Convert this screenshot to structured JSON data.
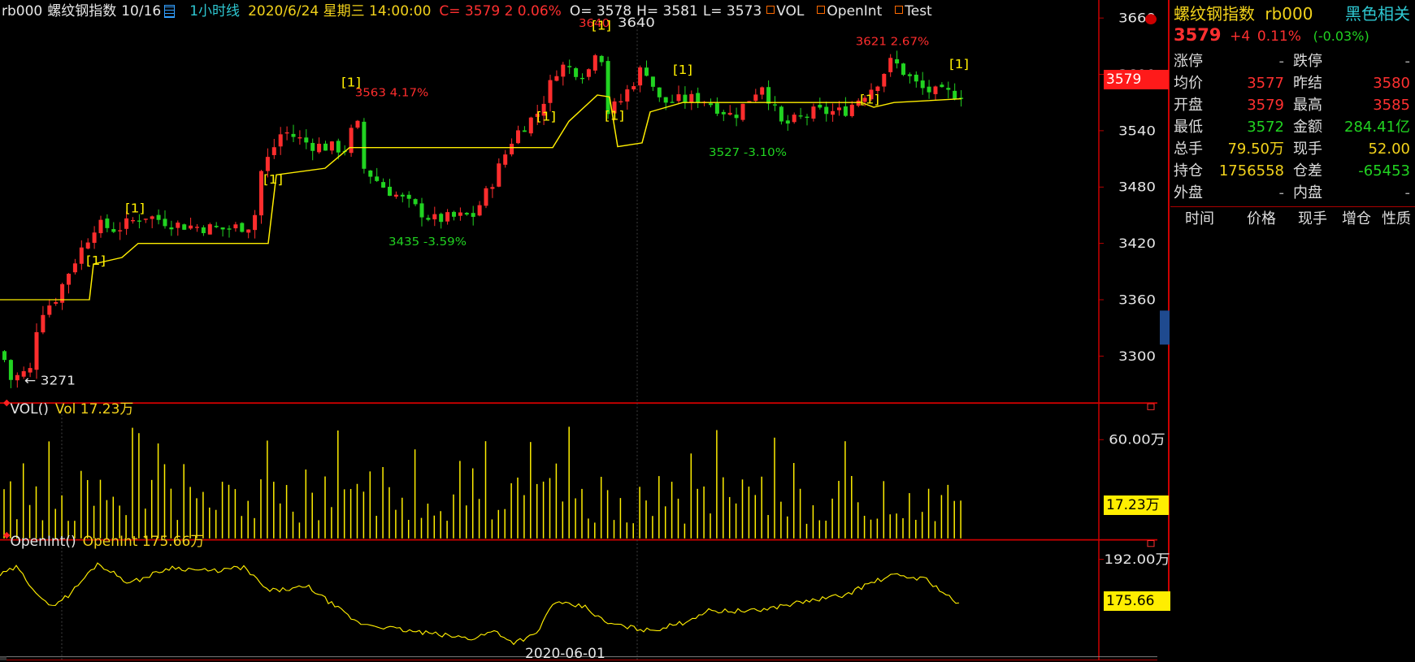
{
  "header": {
    "symbol": "rb000",
    "name": "螺纹钢指数",
    "ratio": "10/16",
    "period": "1小时线",
    "datetime": "2020/6/24 星期三 14:00:00",
    "close": "C= 3579  2  0.06%",
    "open": "O= 3578",
    "high": "H= 3581",
    "low": "L= 3573",
    "ind1": "VOL",
    "ind2": "OpenInt",
    "ind3": "Test"
  },
  "colors": {
    "up": "#ff2d2d",
    "down": "#21d321",
    "yellow": "#ffee00",
    "grid": "#7a0000",
    "axis": "#cc0000"
  },
  "price_axis": {
    "ticks": [
      "3660",
      "3600",
      "3540",
      "3480",
      "3420",
      "3360",
      "3300"
    ],
    "current_tag": "3579"
  },
  "annotations": {
    "low_mark": "3271",
    "peak1": "3563 4.17%",
    "trough1": "3435 -3.59%",
    "peak2_pct": "3640 ",
    "peak2_val": "3640",
    "trough2": "3527 -3.10%",
    "peak3": "3621 2.67%",
    "signal": "[1]"
  },
  "vol_panel": {
    "title": "VOL()",
    "value_label": "Vol 17.23万",
    "tick": "60.00万",
    "current_tag": "17.23万"
  },
  "oi_panel": {
    "title": "OpenInt()",
    "value_label": "OpenInt 175.66万",
    "tick": "192.00万",
    "current_tag": "175.66万"
  },
  "date_axis": {
    "label": "2020-06-01"
  },
  "quote_panel": {
    "title": "螺纹钢指数",
    "code": "rb000",
    "related": "黑色相关",
    "last": "3579",
    "change": "+4",
    "change_pct": "0.11%",
    "change_pct2": "(-0.03%)",
    "rows": [
      {
        "l1": "涨停",
        "v1": "-",
        "l2": "跌停",
        "v2": "-"
      },
      {
        "l1": "均价",
        "v1": "3577",
        "l2": "昨结",
        "v2": "3580"
      },
      {
        "l1": "开盘",
        "v1": "3579",
        "l2": "最高",
        "v2": "3585"
      },
      {
        "l1": "最低",
        "v1": "3572",
        "l2": "金额",
        "v2": "284.41亿"
      },
      {
        "l1": "总手",
        "v1": "79.50万",
        "l2": "现手",
        "v2": "52.00"
      },
      {
        "l1": "持仓",
        "v1": "1756558",
        "l2": "仓差",
        "v2": "-65453"
      },
      {
        "l1": "外盘",
        "v1": "-",
        "l2": "内盘",
        "v2": "-"
      }
    ],
    "tick_headers": [
      "时间",
      "价格",
      "现手",
      "增仓",
      "性质"
    ]
  },
  "chart_data": {
    "type": "candlestick",
    "title": "螺纹钢指数 1小时线",
    "ylim": [
      3250,
      3665
    ],
    "yticks": [
      3300,
      3360,
      3420,
      3480,
      3540,
      3600,
      3660
    ],
    "x_label": "2020-06-01",
    "key_points": [
      {
        "label": "low",
        "value": 3271
      },
      {
        "label": "peak",
        "value": 3563,
        "pct": "4.17%"
      },
      {
        "label": "trough",
        "value": 3435,
        "pct": "-3.59%"
      },
      {
        "label": "peak",
        "value": 3640
      },
      {
        "label": "trough",
        "value": 3527,
        "pct": "-3.10%"
      },
      {
        "label": "peak",
        "value": 3621,
        "pct": "2.67%"
      },
      {
        "label": "last",
        "value": 3579
      }
    ],
    "price_path": [
      [
        0,
        3305
      ],
      [
        10,
        3275
      ],
      [
        35,
        3285
      ],
      [
        45,
        3345
      ],
      [
        65,
        3360
      ],
      [
        85,
        3395
      ],
      [
        115,
        3440
      ],
      [
        140,
        3435
      ],
      [
        175,
        3450
      ],
      [
        215,
        3440
      ],
      [
        270,
        3435
      ],
      [
        310,
        3440
      ],
      [
        315,
        3490
      ],
      [
        345,
        3540
      ],
      [
        380,
        3525
      ],
      [
        425,
        3520
      ],
      [
        435,
        3560
      ],
      [
        445,
        3500
      ],
      [
        470,
        3480
      ],
      [
        530,
        3445
      ],
      [
        580,
        3450
      ],
      [
        600,
        3480
      ],
      [
        630,
        3535
      ],
      [
        660,
        3560
      ],
      [
        685,
        3610
      ],
      [
        720,
        3600
      ],
      [
        735,
        3640
      ],
      [
        745,
        3560
      ],
      [
        760,
        3570
      ],
      [
        790,
        3610
      ],
      [
        810,
        3570
      ],
      [
        860,
        3575
      ],
      [
        900,
        3555
      ],
      [
        935,
        3590
      ],
      [
        960,
        3545
      ],
      [
        1000,
        3560
      ],
      [
        1035,
        3560
      ],
      [
        1075,
        3590
      ],
      [
        1095,
        3615
      ],
      [
        1130,
        3585
      ],
      [
        1150,
        3580
      ],
      [
        1183,
        3579
      ]
    ],
    "vol_ylim": [
      0,
      80
    ],
    "oi_ylim": [
      168,
      196
    ],
    "oi_path": [
      [
        0,
        188
      ],
      [
        20,
        190
      ],
      [
        60,
        180
      ],
      [
        85,
        183
      ],
      [
        120,
        191
      ],
      [
        160,
        186
      ],
      [
        210,
        190
      ],
      [
        260,
        189
      ],
      [
        300,
        190
      ],
      [
        330,
        184
      ],
      [
        380,
        185
      ],
      [
        440,
        176
      ],
      [
        500,
        174
      ],
      [
        540,
        173
      ],
      [
        580,
        172
      ],
      [
        610,
        174
      ],
      [
        630,
        171
      ],
      [
        660,
        173
      ],
      [
        680,
        181
      ],
      [
        720,
        180
      ],
      [
        745,
        176
      ],
      [
        770,
        175
      ],
      [
        800,
        174
      ],
      [
        840,
        176
      ],
      [
        870,
        179
      ],
      [
        930,
        179
      ],
      [
        980,
        181
      ],
      [
        1040,
        183
      ],
      [
        1070,
        186
      ],
      [
        1100,
        188
      ],
      [
        1140,
        187
      ],
      [
        1183,
        180
      ]
    ]
  }
}
